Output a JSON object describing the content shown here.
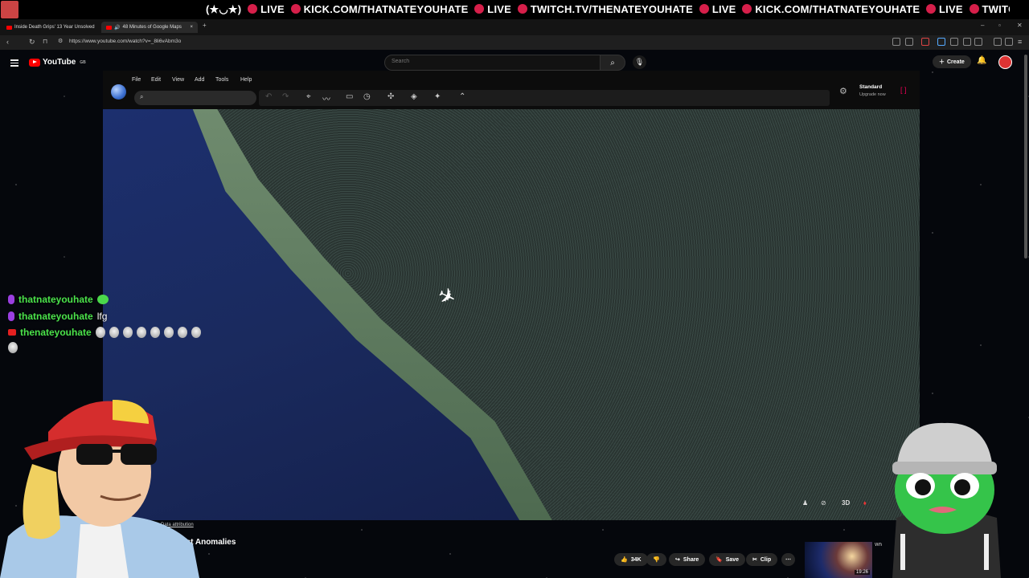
{
  "browser": {
    "tabs": [
      {
        "label": "Inside Death Grips' 13 Year Unsolved",
        "active": false
      },
      {
        "label": "48 Minutes of Google Maps",
        "active": true
      }
    ],
    "new_tab": "+",
    "url": "https://www.youtube.com/watch?v=_8li6vAbm3o"
  },
  "ticker": {
    "prefix": "(★◡★)",
    "segments": [
      "LIVE",
      "KICK.COM/THATNATEYOUHATE",
      "LIVE",
      "TWITCH.TV/THENATEYOUHATE",
      "LIVE",
      "KICK.COM/THATNATEYOUHATE",
      "LIVE",
      "TWITCH.TV/THENATEYOUHATE"
    ]
  },
  "youtube": {
    "logo": "YouTube",
    "country": "GB",
    "search_placeholder": "Search",
    "create_label": "Create",
    "video_title": "est Anomalies",
    "actions": {
      "likes": "34K",
      "share": "Share",
      "save": "Save",
      "clip": "Clip",
      "more": "⋯"
    },
    "sidebar_video": {
      "title": "Wh Ea",
      "duration": "19:26"
    }
  },
  "google_earth": {
    "menu": [
      "File",
      "Edit",
      "View",
      "Add",
      "Tools",
      "Help"
    ],
    "plan": "Standard",
    "upgrade": "Upgrade now",
    "attribution": "Data attribution",
    "view_3d": "3D"
  },
  "chat": [
    {
      "user": "thatnateyouhate",
      "badge": "mic",
      "message": "",
      "emote": "green"
    },
    {
      "user": "thatnateyouhate",
      "badge": "mic",
      "message": "lfg"
    },
    {
      "user": "thenateyouhate",
      "badge": "youtube",
      "message": "",
      "emote_count": 9
    }
  ],
  "colors": {
    "chat_name": "#4be34b",
    "live_dot": "#d61f4a",
    "yt_red": "#ff0000"
  }
}
